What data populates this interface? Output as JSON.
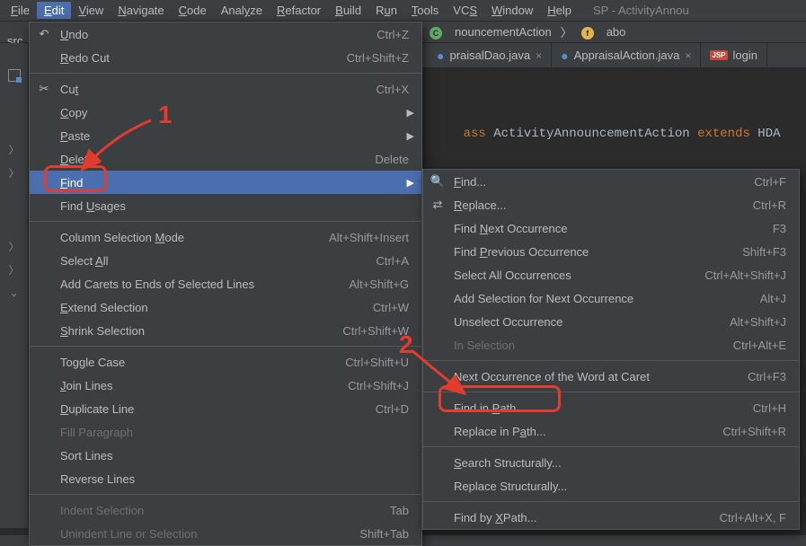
{
  "menu_bar": {
    "items": [
      {
        "label": "File",
        "m": 0
      },
      {
        "label": "Edit",
        "m": 0,
        "active": true
      },
      {
        "label": "View",
        "m": 0
      },
      {
        "label": "Navigate",
        "m": 0
      },
      {
        "label": "Code",
        "m": 0
      },
      {
        "label": "Analyze",
        "m": 4
      },
      {
        "label": "Refactor",
        "m": 0
      },
      {
        "label": "Build",
        "m": 0
      },
      {
        "label": "Run",
        "m": 1
      },
      {
        "label": "Tools",
        "m": 0
      },
      {
        "label": "VCS",
        "m": 2
      },
      {
        "label": "Window",
        "m": 0
      },
      {
        "label": "Help",
        "m": 0
      }
    ],
    "window_title": "SP - ActivityAnnou"
  },
  "breadcrumb": {
    "src_label": "src",
    "class_badge": "C",
    "class_name": "nouncementAction",
    "field_badge": "f",
    "field_name": "abo"
  },
  "tabs": [
    {
      "icon": "java",
      "label": "praisalDao.java",
      "close": true
    },
    {
      "icon": "java",
      "label": "AppraisalAction.java",
      "close": true
    },
    {
      "icon": "jsp",
      "label": "login",
      "close": false
    }
  ],
  "code_line": {
    "kw1": "ass",
    "cls": "ActivityAnnouncementAction",
    "kw2": "extends",
    "ext": "HDA"
  },
  "edit_menu": [
    {
      "label": "Undo",
      "m": 0,
      "sc": "Ctrl+Z",
      "icon": "undo"
    },
    {
      "label": "Redo Cut",
      "m": 0,
      "sc": "Ctrl+Shift+Z"
    },
    {
      "sep": true
    },
    {
      "label": "Cut",
      "m": 2,
      "sc": "Ctrl+X",
      "icon": "cut"
    },
    {
      "label": "Copy",
      "m": 0,
      "sub": true
    },
    {
      "label": "Paste",
      "m": 0,
      "sub": true
    },
    {
      "label": "Delete",
      "m": 0,
      "sc": "Delete"
    },
    {
      "label": "Find",
      "m": 0,
      "sub": true,
      "selected": true
    },
    {
      "label": "Find Usages",
      "m": 5
    },
    {
      "sep": true
    },
    {
      "label": "Column Selection Mode",
      "m": 17,
      "sc": "Alt+Shift+Insert"
    },
    {
      "label": "Select All",
      "m": 7,
      "sc": "Ctrl+A"
    },
    {
      "label": "Add Carets to Ends of Selected Lines",
      "sc": "Alt+Shift+G"
    },
    {
      "label": "Extend Selection",
      "m": 0,
      "sc": "Ctrl+W"
    },
    {
      "label": "Shrink Selection",
      "m": 0,
      "sc": "Ctrl+Shift+W"
    },
    {
      "sep": true
    },
    {
      "label": "Toggle Case",
      "sc": "Ctrl+Shift+U"
    },
    {
      "label": "Join Lines",
      "m": 0,
      "sc": "Ctrl+Shift+J"
    },
    {
      "label": "Duplicate Line",
      "m": 0,
      "sc": "Ctrl+D"
    },
    {
      "label": "Fill Paragraph",
      "dis": true
    },
    {
      "label": "Sort Lines"
    },
    {
      "label": "Reverse Lines"
    },
    {
      "sep": true
    },
    {
      "label": "Indent Selection",
      "dis": true,
      "sc": "Tab"
    },
    {
      "label": "Unindent Line or Selection",
      "dis": true,
      "sc": "Shift+Tab"
    }
  ],
  "find_submenu": [
    {
      "label": "Find...",
      "m": 0,
      "sc": "Ctrl+F",
      "icon": "search"
    },
    {
      "label": "Replace...",
      "m": 0,
      "sc": "Ctrl+R",
      "icon": "replace"
    },
    {
      "label": "Find Next Occurrence",
      "m": 5,
      "sc": "F3"
    },
    {
      "label": "Find Previous Occurrence",
      "m": 5,
      "sc": "Shift+F3"
    },
    {
      "label": "Select All Occurrences",
      "sc": "Ctrl+Alt+Shift+J"
    },
    {
      "label": "Add Selection for Next Occurrence",
      "sc": "Alt+J"
    },
    {
      "label": "Unselect Occurrence",
      "sc": "Alt+Shift+J"
    },
    {
      "label": "In Selection",
      "dis": true,
      "sc": "Ctrl+Alt+E"
    },
    {
      "sep": true
    },
    {
      "label": "Next Occurrence of the Word at Caret",
      "sc": "Ctrl+F3"
    },
    {
      "sep": true
    },
    {
      "label": "Find in Path...",
      "m": 8,
      "sc": "Ctrl+H"
    },
    {
      "label": "Replace in Path...",
      "m": 12,
      "sc": "Ctrl+Shift+R"
    },
    {
      "sep": true
    },
    {
      "label": "Search Structurally...",
      "m": 0
    },
    {
      "label": "Replace Structurally..."
    },
    {
      "sep": true
    },
    {
      "label": "Find by XPath...",
      "m": 8,
      "sc": "Ctrl+Alt+X, F"
    }
  ],
  "annotations": {
    "num1": "1",
    "num2": "2"
  }
}
